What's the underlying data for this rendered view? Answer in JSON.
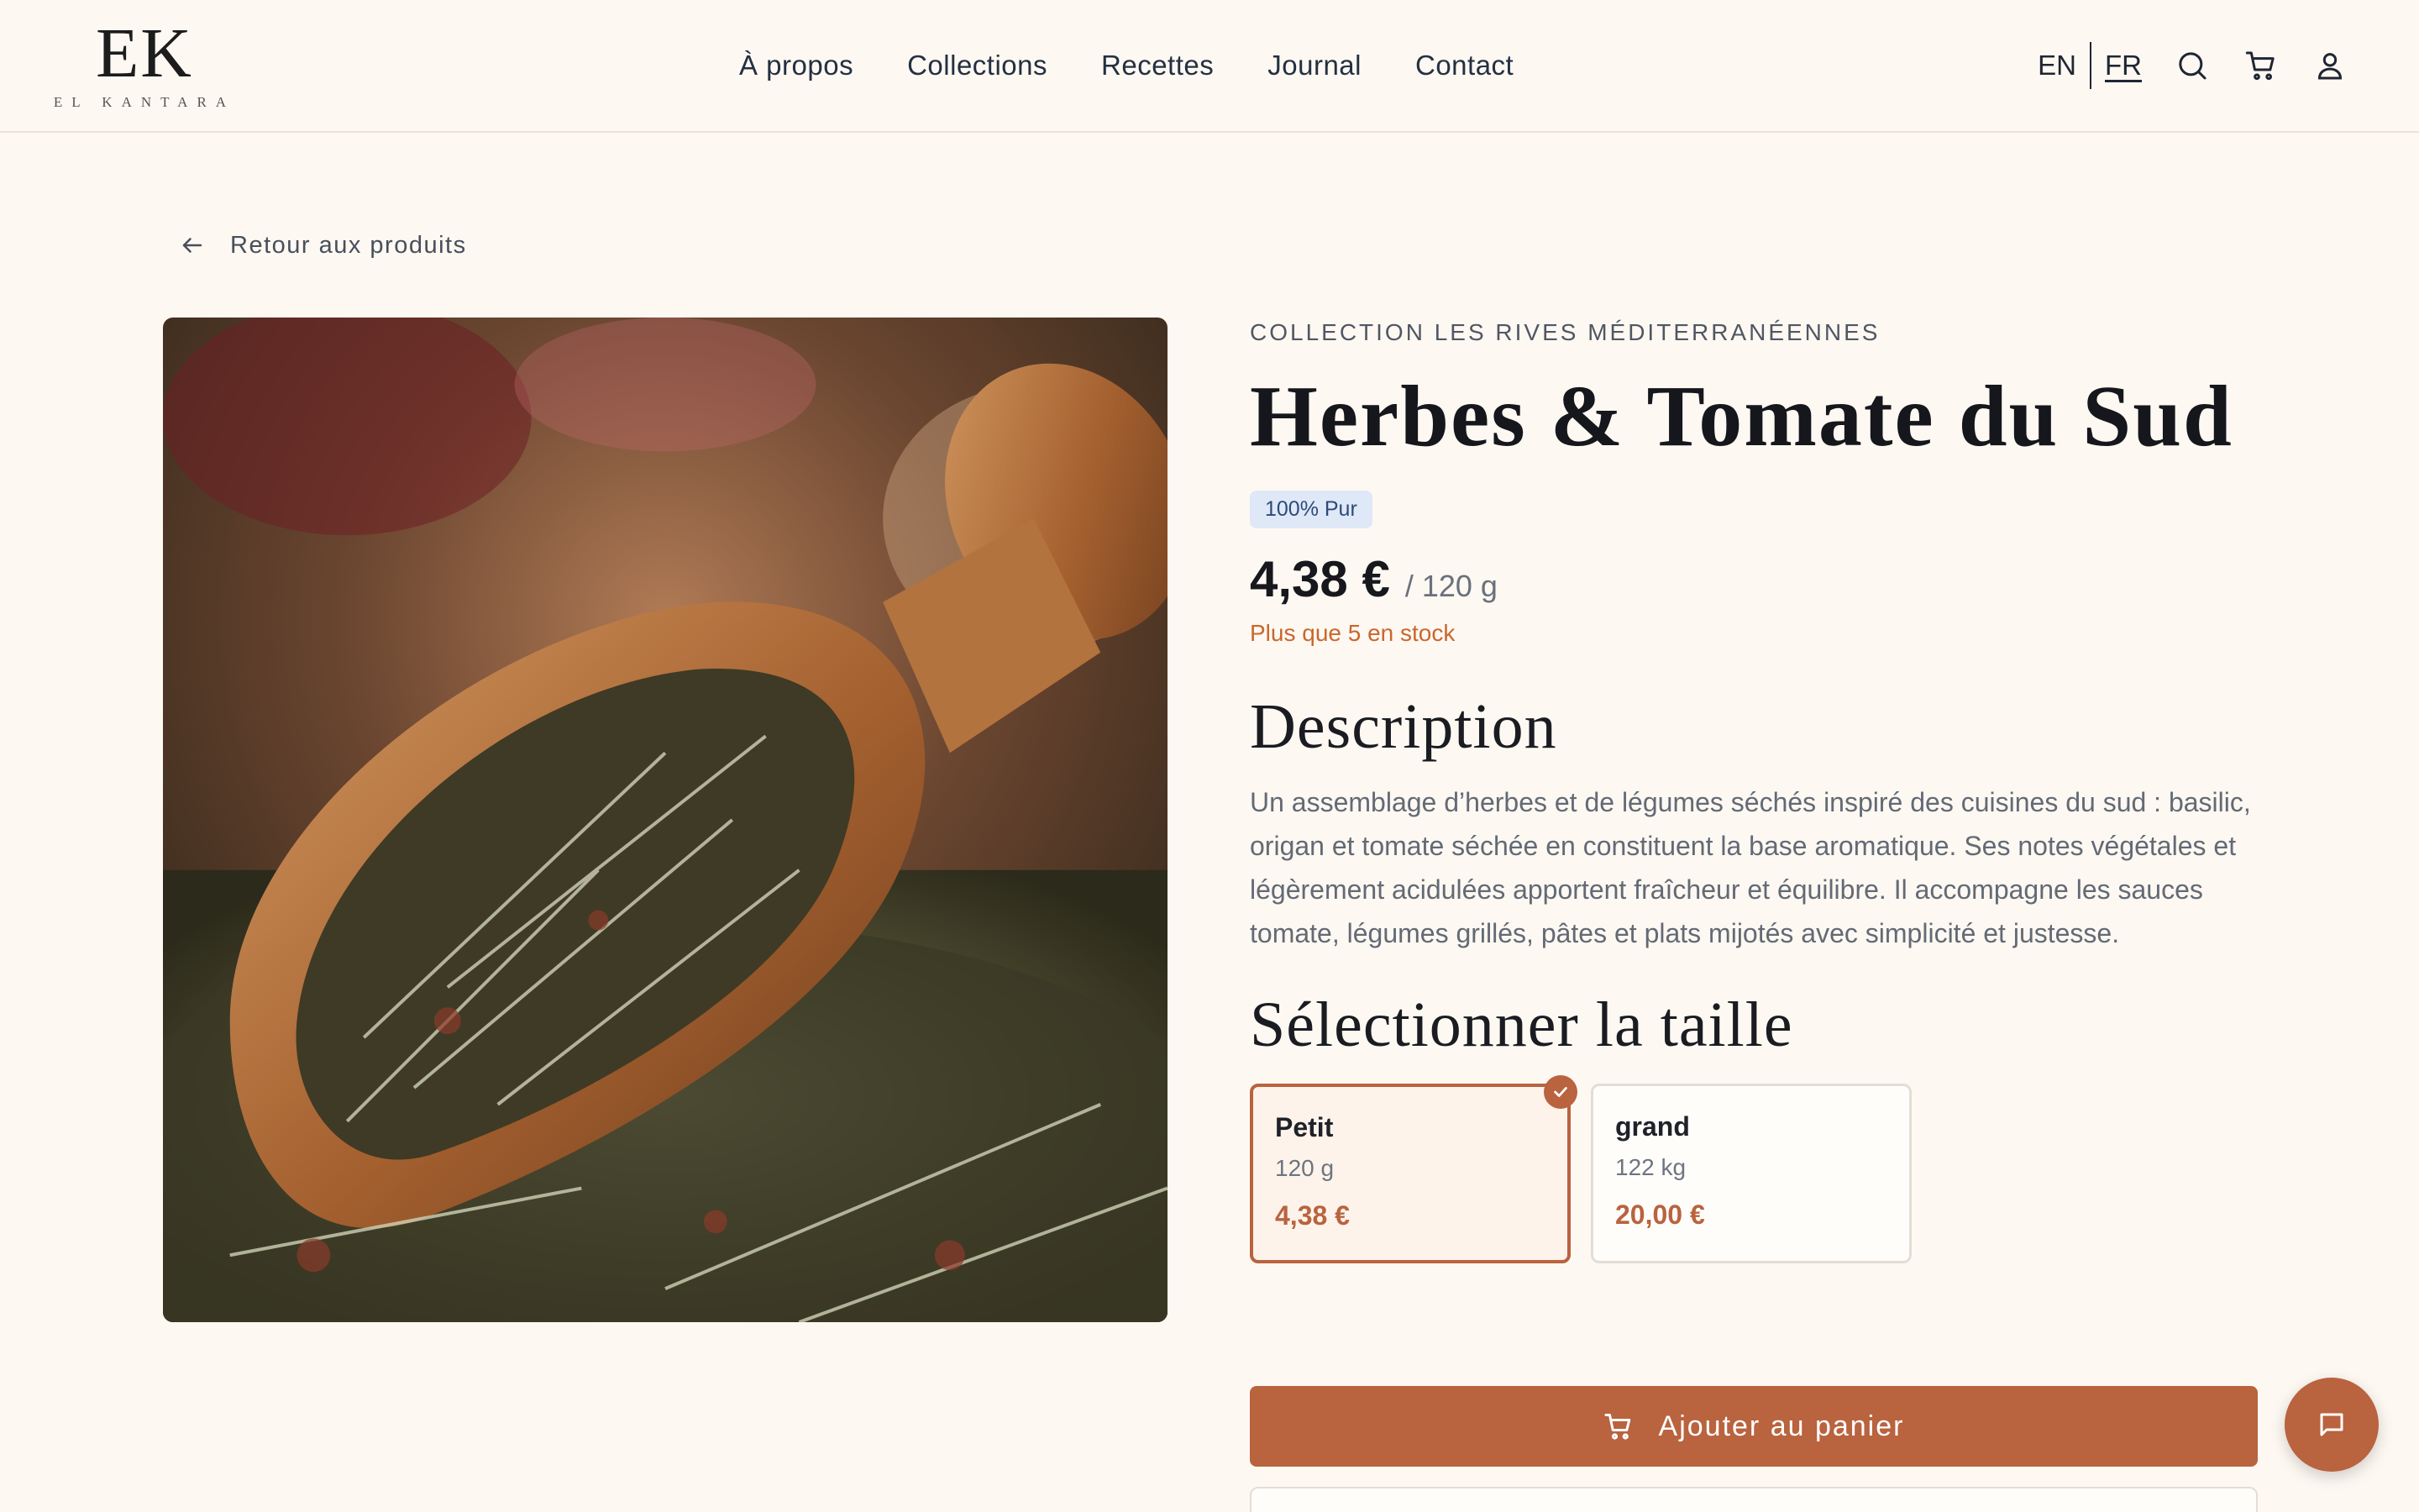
{
  "brand": {
    "mark": "EK",
    "name": "EL KANTARA"
  },
  "nav": [
    {
      "label": "À propos"
    },
    {
      "label": "Collections"
    },
    {
      "label": "Recettes"
    },
    {
      "label": "Journal"
    },
    {
      "label": "Contact"
    }
  ],
  "header": {
    "lang_en": "EN",
    "lang_fr": "FR",
    "active_lang": "FR",
    "icons": [
      "search-icon",
      "cart-icon",
      "user-icon"
    ]
  },
  "back_link": "Retour aux produits",
  "product": {
    "collection": "COLLECTION LES RIVES MÉDITERRANÉENNES",
    "title": "Herbes & Tomate du Sud",
    "badge": "100% Pur",
    "price": "4,38 €",
    "unit": "/ 120 g",
    "stock": "Plus que 5 en stock",
    "description_heading": "Description",
    "description": "Un assemblage d’herbes et de légumes séchés inspiré des cuisines du sud : basilic, origan et tomate séchée en constituent la base aromatique. Ses notes végétales et légèrement acidulées apportent fraîcheur et équilibre. Il accompagne les sauces tomate, légumes grillés, pâtes et plats mijotés avec simplicité et justesse.",
    "size_heading": "Sélectionner la taille",
    "sizes": [
      {
        "name": "Petit",
        "weight": "120 g",
        "price": "4,38 €",
        "selected": true
      },
      {
        "name": "grand",
        "weight": "122 kg",
        "price": "20,00 €",
        "selected": false
      }
    ],
    "add_to_cart": "Ajouter au panier"
  },
  "colors": {
    "accent": "#b9633f",
    "background": "#fdf8f2",
    "stock_warning": "#c9672d",
    "badge_bg": "#dfe8f7"
  }
}
